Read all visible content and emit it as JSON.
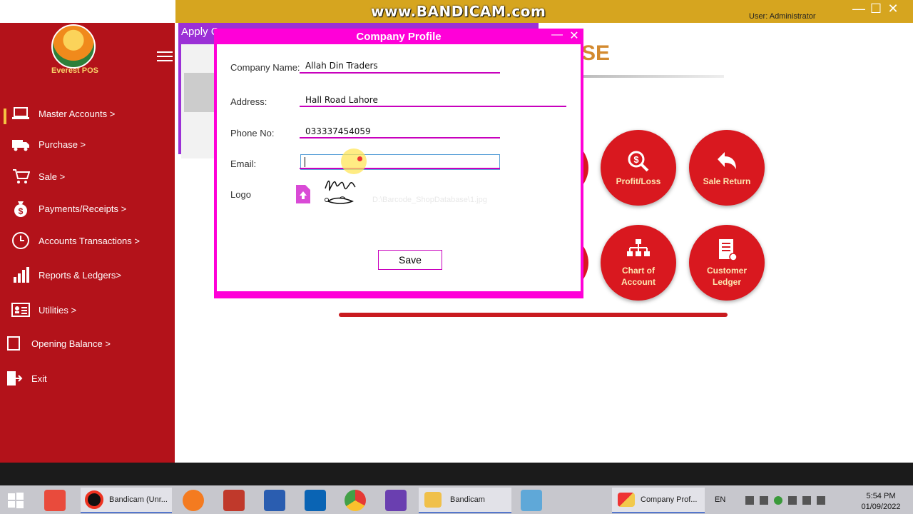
{
  "topbar": {
    "watermark": "www.BANDICAM.com",
    "user_label": "User: Administrator",
    "min": "—",
    "max": "☐",
    "close": "✕"
  },
  "sidebar": {
    "logo_text": "Everest POS",
    "items": [
      {
        "label": "Master Accounts >",
        "icon": "laptop-icon"
      },
      {
        "label": "Purchase >",
        "icon": "truck-icon"
      },
      {
        "label": "Sale >",
        "icon": "cart-icon"
      },
      {
        "label": "Payments/Receipts >",
        "icon": "money-bag-icon"
      },
      {
        "label": "Accounts Transactions >",
        "icon": "clock-icon"
      },
      {
        "label": "Reports & Ledgers>",
        "icon": "bar-chart-icon"
      },
      {
        "label": "Utilities >",
        "icon": "id-card-icon"
      },
      {
        "label": "Opening Balance >",
        "icon": "document-icon"
      },
      {
        "label": "Exit",
        "icon": "exit-icon"
      }
    ]
  },
  "background": {
    "apply_title": "Apply C",
    "heading_fragment": "SE",
    "buttons": [
      {
        "label": "Profit/Loss",
        "icon": "search-money-icon"
      },
      {
        "label": "Sale Return",
        "icon": "return-arrow-icon"
      },
      {
        "label": "Chart of Account",
        "icon": "org-chart-icon"
      },
      {
        "label": "Customer Ledger",
        "icon": "ledger-icon"
      }
    ]
  },
  "dialog": {
    "title": "Company Profile",
    "min": "—",
    "close": "✕",
    "fields": {
      "company_name_label": "Company Name:",
      "company_name_value": "Allah Din Traders",
      "address_label": "Address:",
      "address_value": "Hall Road Lahore",
      "phone_label": "Phone No:",
      "phone_value": "033337454059",
      "email_label": "Email:",
      "email_value": "",
      "logo_label": "Logo",
      "logo_path": "D:\\Barcode_ShopDatabase\\1.jpg"
    },
    "save_label": "Save"
  },
  "taskbar": {
    "items": [
      {
        "label": "Bandicam (Unr...",
        "icon": "bandicam-icon"
      },
      {
        "label": "Bandicam",
        "icon": "folder-icon"
      },
      {
        "label": "Company Prof...",
        "icon": "app-window-icon"
      }
    ],
    "lang": "EN",
    "time": "5:54 PM",
    "date": "01/09/2022"
  },
  "colors": {
    "sidebar": "#b3121a",
    "accent_magenta": "#ff00d8",
    "gold": "#d6a51f",
    "circle_red": "#d9181f"
  }
}
